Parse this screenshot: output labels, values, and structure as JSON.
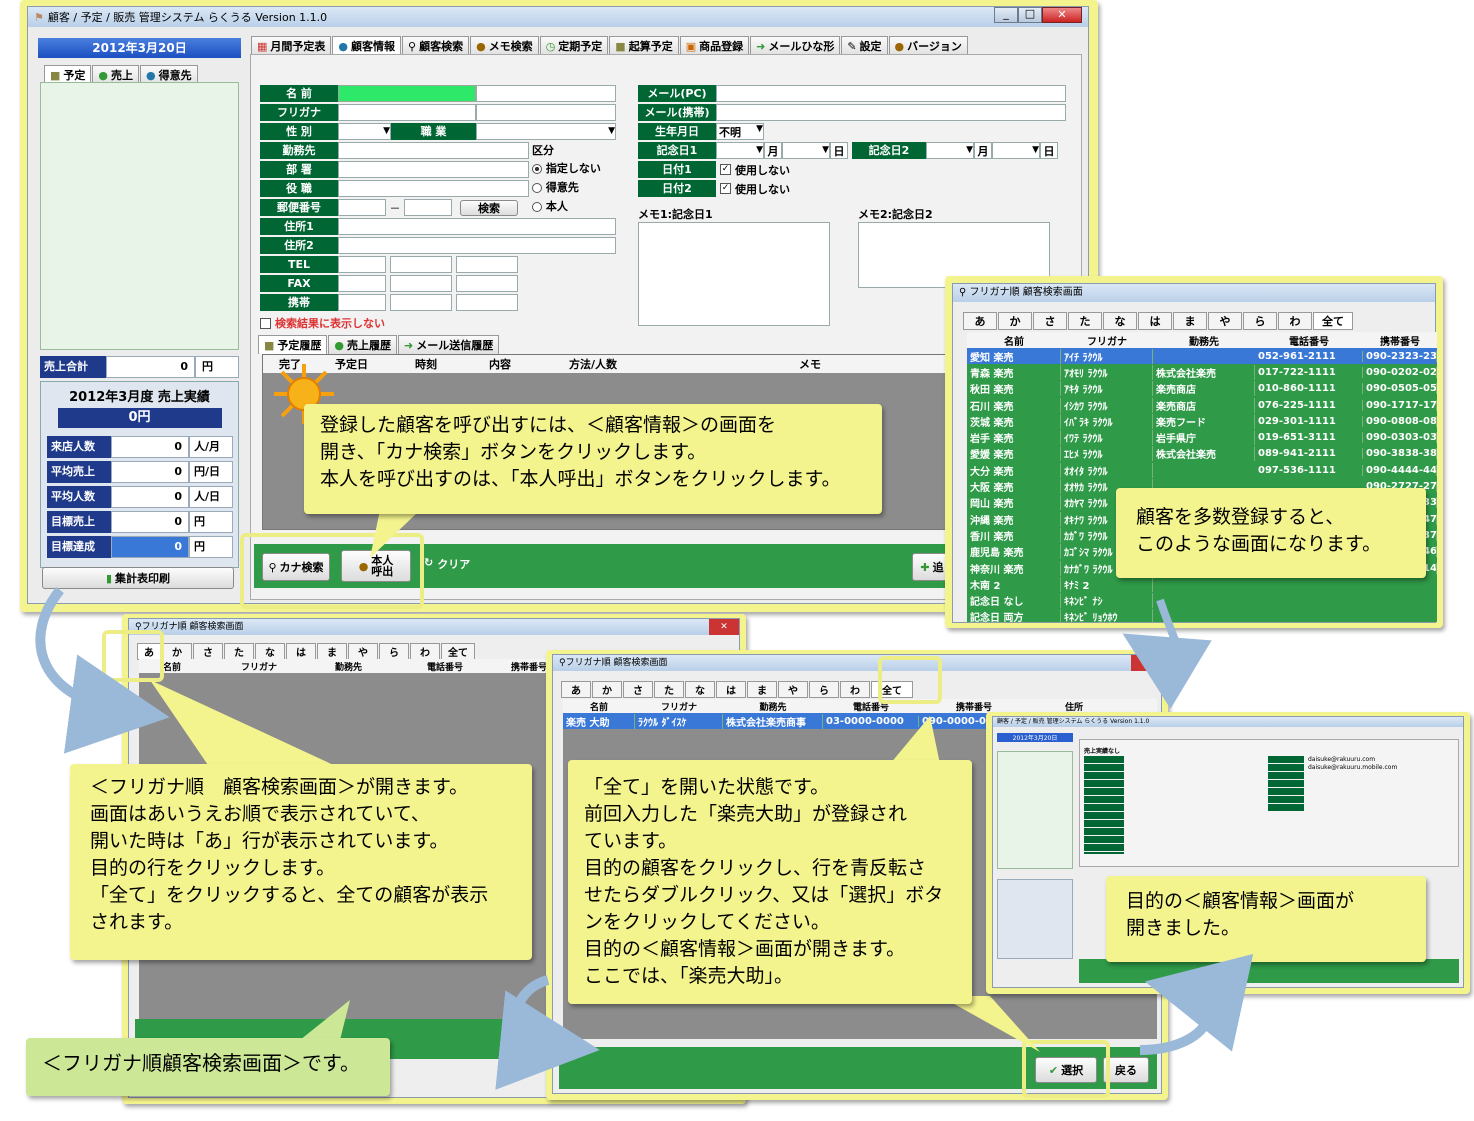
{
  "main": {
    "title": "顧客 / 予定 / 販売 管理システム らくうる  Version 1.1.0",
    "date": "2012年3月20日",
    "left_tabs": [
      "予定",
      "売上",
      "得意先"
    ],
    "sales_total_label": "売上合計",
    "sales_total_value": "0",
    "yen": "円",
    "monthly_title": "2012年3月度 売上実績",
    "monthly_value": "0円",
    "stats": [
      {
        "label": "来店人数",
        "value": "0",
        "unit": "人/月"
      },
      {
        "label": "平均売上",
        "value": "0",
        "unit": "円/日"
      },
      {
        "label": "平均人数",
        "value": "0",
        "unit": "人/日"
      },
      {
        "label": "目標売上",
        "value": "0",
        "unit": "円"
      },
      {
        "label": "目標達成",
        "value": "0",
        "unit": "円"
      }
    ],
    "print_button": "集計表印刷",
    "tabs": [
      "月間予定表",
      "顧客情報",
      "顧客検索",
      "メモ検索",
      "定期予定",
      "起算予定",
      "商品登録",
      "メールひな形",
      "設定",
      "バージョン"
    ],
    "fields": {
      "name": "名 前",
      "furigana": "フリガナ",
      "gender": "性 別",
      "job": "職 業",
      "company": "勤務先",
      "dept": "部 署",
      "post": "役 職",
      "zip": "郵便番号",
      "zip_search": "検索",
      "addr1": "住所1",
      "addr2": "住所2",
      "tel": "TEL",
      "fax": "FAX",
      "mobile": "携帯",
      "dash": "－"
    },
    "kubun": {
      "title": "区分",
      "options": [
        "指定しない",
        "得意先",
        "本人"
      ]
    },
    "mail_pc": "メール(PC)",
    "mail_mobile": "メール(携帯)",
    "birthday": "生年月日",
    "birthday_value": "不明",
    "anniv1": "記念日1",
    "anniv2": "記念日2",
    "month": "月",
    "day": "日",
    "date1": "日付1",
    "date2": "日付2",
    "unused": "使用しない",
    "memo1": "メモ1:記念日1",
    "memo2": "メモ2:記念日2",
    "hide_results": "検索結果に表示しない",
    "hist_tabs": [
      "予定履歴",
      "売上履歴",
      "メール送信履歴"
    ],
    "hist_cols": [
      "完了",
      "予定日",
      "時刻",
      "内容",
      "方法/人数",
      "メモ"
    ],
    "kana_search": "カナ検索",
    "honnin_line1": "本人",
    "honnin_line2": "呼出",
    "clear": "クリア",
    "add_partial": "追"
  },
  "callouts": {
    "c1": [
      "登録した顧客を呼び出すには、＜顧客情報＞の画面を",
      "開き、「カナ検索」ボタンをクリックします。",
      "本人を呼び出すのは、「本人呼出」ボタンをクリックします。"
    ],
    "c2": [
      "顧客を多数登録すると、",
      "このような画面になります。"
    ],
    "c3": [
      "＜フリガナ順　顧客検索画面＞が開きます。",
      "画面はあいうえお順で表示されていて、",
      "開いた時は「あ」行が表示されています。",
      "目的の行をクリックします。",
      "「全て」をクリックすると、全ての顧客が表示",
      "されます。"
    ],
    "c4": "＜フリガナ順顧客検索画面＞です。",
    "c5": [
      "「全て」を開いた状態です。",
      "前回入力した「楽売大助」が登録され",
      "ています。",
      "目的の顧客をクリックし、行を青反転さ",
      "せたらダブルクリック、又は「選択」ボタ",
      "ンをクリックしてください。",
      "目的の＜顧客情報＞画面が開きます。",
      "ここでは、「楽売大助」。"
    ],
    "c6": [
      "目的の＜顧客情報＞画面が",
      "開きました。"
    ]
  },
  "search": {
    "title": "フリガナ順 顧客検索画面",
    "kana_tabs": [
      "あ",
      "か",
      "さ",
      "た",
      "な",
      "は",
      "ま",
      "や",
      "ら",
      "わ",
      "全て"
    ],
    "cols": [
      "名前",
      "フリガナ",
      "勤務先",
      "電話番号",
      "携帯番号",
      "住所"
    ],
    "rows": [
      [
        "愛知 楽売",
        "ｱｲﾁ ﾗｸｳﾙ",
        "",
        "052-961-2111",
        "090-2323-232"
      ],
      [
        "青森 楽売",
        "ｱｵﾓﾘ ﾗｸｳﾙ",
        "株式会社楽売",
        "017-722-1111",
        "090-0202-020"
      ],
      [
        "秋田 楽売",
        "ｱｷﾀ ﾗｸｳﾙ",
        "楽売商店",
        "010-860-1111",
        "090-0505-050"
      ],
      [
        "石川 楽売",
        "ｲｼｶﾜ ﾗｸｳﾙ",
        "楽売商店",
        "076-225-1111",
        "090-1717-171"
      ],
      [
        "茨城 楽売",
        "ｲﾊﾞﾗｷ ﾗｸｳﾙ",
        "楽売フード",
        "029-301-1111",
        "090-0808-080"
      ],
      [
        "岩手 楽売",
        "ｲﾜﾃ ﾗｸｳﾙ",
        "岩手県庁",
        "019-651-3111",
        "090-0303-030"
      ],
      [
        "愛媛 楽売",
        "ｴﾋﾒ ﾗｸｳﾙ",
        "株式会社楽売",
        "089-941-2111",
        "090-3838-383"
      ],
      [
        "大分 楽売",
        "ｵｵｲﾀ ﾗｸｳﾙ",
        "",
        "097-536-1111",
        "090-4444-444"
      ],
      [
        "大阪 楽売",
        "ｵｵｻｶ ﾗｸｳﾙ",
        "",
        "",
        "090-2727-272"
      ],
      [
        "岡山 楽売",
        "ｵｶﾔﾏ ﾗｸｳﾙ",
        "",
        "",
        "090-3333-333"
      ],
      [
        "沖縄 楽売",
        "ｵｷﾅﾜ ﾗｸｳﾙ",
        "",
        "",
        "090-4747-474"
      ],
      [
        "香川 楽売",
        "ｶｶﾞﾜ ﾗｸｳﾙ",
        "",
        "",
        "090-3737-373"
      ],
      [
        "鹿児島 楽売",
        "ｶｺﾞｼﾏ ﾗｸｳﾙ",
        "",
        "",
        "090-4646-464"
      ],
      [
        "神奈川 楽売",
        "ｶﾅｶﾞﾜ ﾗｸｳﾙ",
        "",
        "",
        "090-1414-141"
      ],
      [
        "木南 2",
        "ｷﾅﾐ 2",
        "",
        "",
        ""
      ],
      [
        "記念日 なし",
        "ｷﾈﾝﾋﾞ ﾅｼ",
        "",
        "",
        ""
      ],
      [
        "記念日 両方",
        "ｷﾈﾝﾋﾞ ﾘｮｳﾎｳ",
        "",
        "",
        ""
      ]
    ],
    "row2": [
      "楽売 大助",
      "ﾗｸｳﾙ ﾀﾞｲｽｹ",
      "株式会社楽売商事",
      "03-0000-0000",
      "090-0000-000"
    ],
    "select": "選択",
    "back": "戻る"
  },
  "small": {
    "title": "顧客 / 予定 / 販売 管理システム らくうる Version 1.1.0",
    "sub": "売上実績なし",
    "mail": "daisuke@rakuuru.com",
    "mail2": "daisuke@rakuuru.mobile.com"
  },
  "colors": {
    "green": "#006633",
    "yellow": "#f4f48e",
    "blue": "#3a78d8"
  }
}
